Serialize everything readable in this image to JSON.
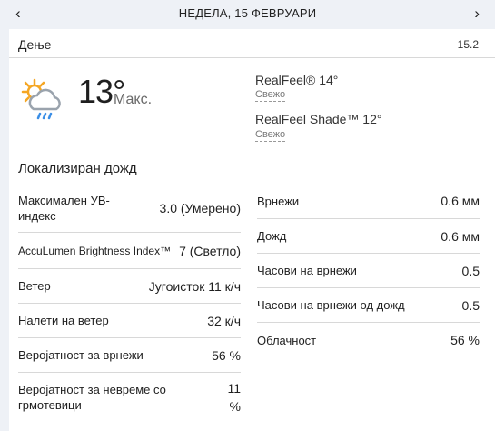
{
  "nav": {
    "date": "НЕДЕЛА, 15 ФЕВРУАРИ",
    "prev_icon": "chevron-left-icon",
    "next_icon": "chevron-right-icon"
  },
  "day": {
    "label": "Дење",
    "number": "15.2",
    "icon": "partly-sunny-rain-icon",
    "temp": "13°",
    "temp_label": "Макс.",
    "realfeel": "RealFeel® 14°",
    "realfeel_sub": "Свежо",
    "realfeel_shade": "RealFeel Shade™ 12°",
    "realfeel_shade_sub": "Свежо",
    "phrase": "Локализиран дожд"
  },
  "left_details": [
    {
      "key": "Максимален УВ-индекс",
      "value": "3.0 (Умерено)"
    },
    {
      "key": "AccuLumen Brightness Index™",
      "value": "7 (Светло)"
    },
    {
      "key": "Ветер",
      "value": "Југоисток 11 к/ч"
    },
    {
      "key": "Налети на ветер",
      "value": "32 к/ч"
    },
    {
      "key": "Веројатност за врнежи",
      "value": "56 %"
    },
    {
      "key": "Веројатност за невреме со грмотевици",
      "value": "11 %"
    }
  ],
  "right_details": [
    {
      "key": "Врнежи",
      "value": "0.6 мм"
    },
    {
      "key": "Дожд",
      "value": "0.6 мм"
    },
    {
      "key": "Часови на врнежи",
      "value": "0.5"
    },
    {
      "key": "Часови на врнежи од дожд",
      "value": "0.5"
    },
    {
      "key": "Облачност",
      "value": "56 %"
    }
  ],
  "colors": {
    "accent_sun": "#f5a623",
    "cloud": "#9aa3ad",
    "rain": "#3a8ee6"
  }
}
